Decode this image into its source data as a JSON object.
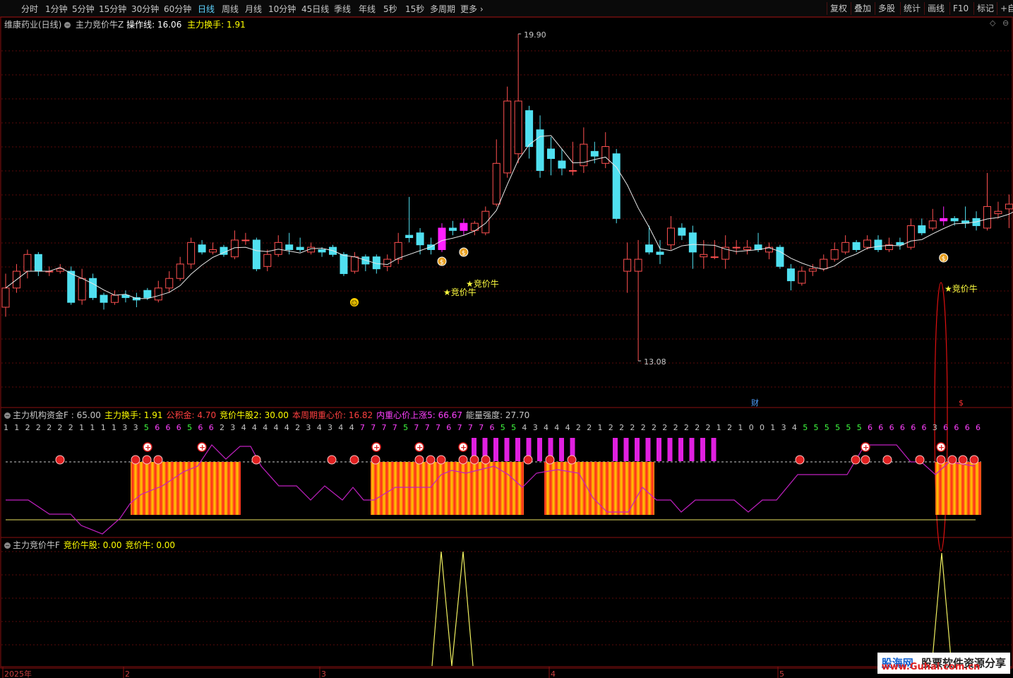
{
  "toolbar": {
    "periods": [
      "分时",
      "1分钟",
      "5分钟",
      "15分钟",
      "30分钟",
      "60分钟",
      "日线",
      "周线",
      "月线",
      "10分钟",
      "45日线",
      "季线",
      "年线",
      "5秒",
      "15秒",
      "多周期",
      "更多"
    ],
    "active_period": "日线",
    "right_buttons": [
      "复权",
      "叠加",
      "多股",
      "统计",
      "画线",
      "F10",
      "标记",
      "+自"
    ]
  },
  "main_panel": {
    "stock_name": "维康药业(日线)",
    "indicator": "主力竞价牛Z",
    "op_line_label": "操作线:",
    "op_line_value": "16.06",
    "turnover_label": "主力换手:",
    "turnover_value": "1.91",
    "high_label": "19.90",
    "low_label": "13.08",
    "signal_label": "★竞价牛",
    "fin_badge": "财",
    "dollar_badge": "$"
  },
  "middle_panel": {
    "title": "主力机构资金F",
    "items": [
      {
        "label": "主力机构资金F :",
        "value": "65.00",
        "color": "#c8c8c8"
      },
      {
        "label": "主力换手:",
        "value": "1.91",
        "color": "#ffff00"
      },
      {
        "label": "公积金:",
        "value": "4.70",
        "color": "#ff4040"
      },
      {
        "label": "竞价牛股2:",
        "value": "30.00",
        "color": "#ffff00"
      },
      {
        "label": "本周期重心价:",
        "value": "16.82",
        "color": "#ff4040"
      },
      {
        "label": "内重心价上涨5:",
        "value": "66.67",
        "color": "#ff40ff"
      },
      {
        "label": "能量强度:",
        "value": "27.70",
        "color": "#c8c8c8"
      }
    ],
    "digits": "1122222111133566656623444442343447777577767776554344422122222222221210013455555566666636666"
  },
  "bottom_panel": {
    "items": [
      {
        "label": "主力竞价牛F",
        "value": "",
        "color": "#c8c8c8"
      },
      {
        "label": "竞价牛股:",
        "value": "0.00",
        "color": "#ffff00"
      },
      {
        "label": "竞价牛:",
        "value": "0.00",
        "color": "#ffff00"
      }
    ]
  },
  "x_axis": {
    "labels": [
      {
        "text": "2025年"
      },
      {
        "text": "2"
      },
      {
        "text": "3"
      },
      {
        "text": "4"
      },
      {
        "text": "5"
      }
    ]
  },
  "watermark": {
    "brand": "股海网",
    "slogan": "股票软件资源分享",
    "url": "www.Guhai.com.cn"
  },
  "chart_data": {
    "type": "candlestick",
    "price_range": [
      13.08,
      19.9
    ],
    "high": 19.9,
    "low": 13.08,
    "candles": [
      [
        14.2,
        14.6,
        14.9,
        14.0
      ],
      [
        14.6,
        14.95,
        15.1,
        14.5
      ],
      [
        14.95,
        15.3,
        15.4,
        14.8
      ],
      [
        15.3,
        14.95,
        15.35,
        14.85
      ],
      [
        14.95,
        14.95,
        15.05,
        14.85
      ],
      [
        14.95,
        15.0,
        15.1,
        14.9
      ],
      [
        14.95,
        14.3,
        15.05,
        14.25
      ],
      [
        14.35,
        14.8,
        15.0,
        14.25
      ],
      [
        14.8,
        14.4,
        14.9,
        14.35
      ],
      [
        14.45,
        14.3,
        14.5,
        14.15
      ],
      [
        14.3,
        14.45,
        14.55,
        14.25
      ],
      [
        14.45,
        14.4,
        14.55,
        14.3
      ],
      [
        14.4,
        14.35,
        14.5,
        14.2
      ],
      [
        14.55,
        14.4,
        14.6,
        14.35
      ],
      [
        14.35,
        14.6,
        14.75,
        14.3
      ],
      [
        14.6,
        14.8,
        14.95,
        14.5
      ],
      [
        14.8,
        15.1,
        15.25,
        14.75
      ],
      [
        15.1,
        15.55,
        15.65,
        15.0
      ],
      [
        15.5,
        15.35,
        15.6,
        15.3
      ],
      [
        15.35,
        15.4,
        15.55,
        15.3
      ],
      [
        15.45,
        15.3,
        15.5,
        15.25
      ],
      [
        15.25,
        15.6,
        15.8,
        15.2
      ],
      [
        15.6,
        15.6,
        15.75,
        15.5
      ],
      [
        15.6,
        15.0,
        15.65,
        14.95
      ],
      [
        15.05,
        15.3,
        15.4,
        14.95
      ],
      [
        15.3,
        15.55,
        15.7,
        15.25
      ],
      [
        15.5,
        15.4,
        15.75,
        15.3
      ],
      [
        15.45,
        15.4,
        15.65,
        15.35
      ],
      [
        15.35,
        15.45,
        15.55,
        15.3
      ],
      [
        15.4,
        15.35,
        15.45,
        15.25
      ],
      [
        15.45,
        15.3,
        15.5,
        15.25
      ],
      [
        15.3,
        14.9,
        15.35,
        14.85
      ],
      [
        14.95,
        15.25,
        15.35,
        14.9
      ],
      [
        15.25,
        15.1,
        15.3,
        14.95
      ],
      [
        15.25,
        15.0,
        15.3,
        14.9
      ],
      [
        15.05,
        15.2,
        15.3,
        14.95
      ],
      [
        15.2,
        15.55,
        15.75,
        15.1
      ],
      [
        15.7,
        15.65,
        16.5,
        15.55
      ],
      [
        15.75,
        15.5,
        15.85,
        15.3
      ],
      [
        15.5,
        15.4,
        15.65,
        15.3
      ],
      [
        15.4,
        15.85,
        15.95,
        15.35
      ],
      [
        15.85,
        15.8,
        16.0,
        15.7
      ],
      [
        15.8,
        15.95,
        16.05,
        15.7
      ],
      [
        15.8,
        15.95,
        16.0,
        15.7
      ],
      [
        15.75,
        16.2,
        16.3,
        15.7
      ],
      [
        16.35,
        17.2,
        17.7,
        16.3
      ],
      [
        17.0,
        18.5,
        18.8,
        16.9
      ],
      [
        17.4,
        18.5,
        19.9,
        17.2
      ],
      [
        18.3,
        17.55,
        18.4,
        17.3
      ],
      [
        17.9,
        17.05,
        18.2,
        16.9
      ],
      [
        17.5,
        17.3,
        17.75,
        16.95
      ],
      [
        17.25,
        17.1,
        17.5,
        16.95
      ],
      [
        17.05,
        17.05,
        17.65,
        16.95
      ],
      [
        17.15,
        17.6,
        17.95,
        17.0
      ],
      [
        17.45,
        17.35,
        17.65,
        17.2
      ],
      [
        17.2,
        17.55,
        17.85,
        17.1
      ],
      [
        17.4,
        16.05,
        17.5,
        15.95
      ],
      [
        14.95,
        15.2,
        15.55,
        14.5
      ],
      [
        14.95,
        15.2,
        15.6,
        13.08
      ],
      [
        15.5,
        15.35,
        15.9,
        15.3
      ],
      [
        15.35,
        15.3,
        15.6,
        15.1
      ],
      [
        15.5,
        15.85,
        16.1,
        15.4
      ],
      [
        15.85,
        15.7,
        15.95,
        15.6
      ],
      [
        15.75,
        15.35,
        15.9,
        15.0
      ],
      [
        15.25,
        15.3,
        15.6,
        15.0
      ],
      [
        15.25,
        15.25,
        15.6,
        15.2
      ],
      [
        15.2,
        15.45,
        15.7,
        15.0
      ],
      [
        15.45,
        15.45,
        15.6,
        15.3
      ],
      [
        15.4,
        15.45,
        15.6,
        15.3
      ],
      [
        15.5,
        15.4,
        15.75,
        15.35
      ],
      [
        15.35,
        15.45,
        15.55,
        15.2
      ],
      [
        15.45,
        15.05,
        15.5,
        15.0
      ],
      [
        15.0,
        14.75,
        15.1,
        14.55
      ],
      [
        14.7,
        14.95,
        15.05,
        14.65
      ],
      [
        14.95,
        15.0,
        15.1,
        14.85
      ],
      [
        15.0,
        15.2,
        15.3,
        14.95
      ],
      [
        15.2,
        15.4,
        15.55,
        15.15
      ],
      [
        15.35,
        15.55,
        15.7,
        15.3
      ],
      [
        15.55,
        15.4,
        15.6,
        15.35
      ],
      [
        15.45,
        15.6,
        15.7,
        15.4
      ],
      [
        15.6,
        15.4,
        15.7,
        15.35
      ],
      [
        15.4,
        15.5,
        15.65,
        15.35
      ],
      [
        15.55,
        15.5,
        15.65,
        15.4
      ],
      [
        15.45,
        15.9,
        16.05,
        15.4
      ],
      [
        15.9,
        15.75,
        16.05,
        15.7
      ],
      [
        15.85,
        16.0,
        16.25,
        15.8
      ],
      [
        16.0,
        16.05,
        16.3,
        15.9
      ],
      [
        16.05,
        16.0,
        16.1,
        15.9
      ],
      [
        16.0,
        15.95,
        16.3,
        15.85
      ],
      [
        16.05,
        15.9,
        16.2,
        15.8
      ],
      [
        15.85,
        16.3,
        17.0,
        15.8
      ],
      [
        16.15,
        16.2,
        16.4,
        16.05
      ],
      [
        16.25,
        16.35,
        16.55,
        15.85
      ],
      [
        16.45,
        16.55,
        16.75,
        16.35
      ],
      [
        16.6,
        17.05,
        17.55,
        16.55
      ]
    ]
  }
}
